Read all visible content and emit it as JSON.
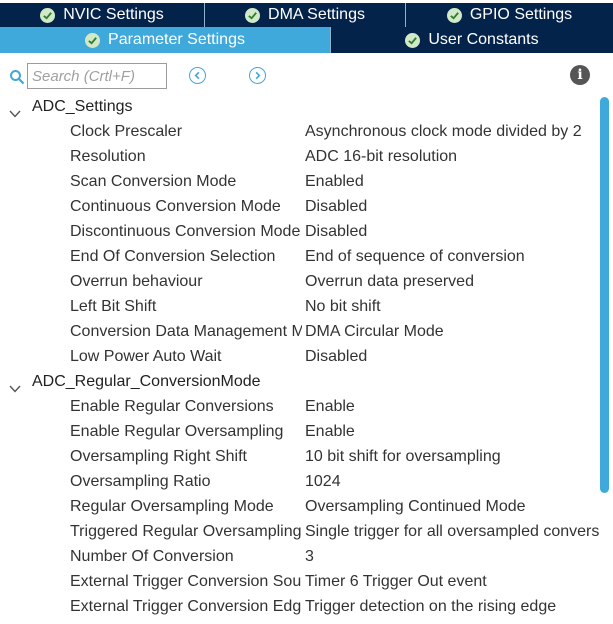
{
  "tabs_top": [
    {
      "label": "NVIC Settings"
    },
    {
      "label": "DMA Settings"
    },
    {
      "label": "GPIO Settings"
    }
  ],
  "tabs_bottom": [
    {
      "label": "Parameter Settings",
      "active": true
    },
    {
      "label": "User Constants",
      "active": false
    }
  ],
  "search": {
    "placeholder": "Search (Crtl+F)"
  },
  "icons": {
    "search": "search-icon",
    "prev": "arrow-left-icon",
    "next": "arrow-right-icon",
    "info": "info-icon"
  },
  "colors": {
    "tab_dark": "#03234b",
    "tab_active": "#3fa9dc",
    "scroll_thumb": "#3fa9dc"
  },
  "groups": [
    {
      "label": "ADC_Settings",
      "params": [
        {
          "name": "Clock Prescaler",
          "value": "Asynchronous clock mode divided by 2"
        },
        {
          "name": "Resolution",
          "value": "ADC 16-bit resolution"
        },
        {
          "name": "Scan Conversion Mode",
          "value": "Enabled"
        },
        {
          "name": "Continuous Conversion Mode",
          "value": "Disabled"
        },
        {
          "name": "Discontinuous Conversion Mode",
          "value": "Disabled"
        },
        {
          "name": "End Of Conversion Selection",
          "value": "End of sequence of conversion"
        },
        {
          "name": "Overrun behaviour",
          "value": "Overrun data preserved"
        },
        {
          "name": "Left Bit Shift",
          "value": "No bit shift"
        },
        {
          "name": "Conversion Data Management M.",
          "value": "DMA Circular Mode"
        },
        {
          "name": "Low Power Auto Wait",
          "value": "Disabled"
        }
      ]
    },
    {
      "label": "ADC_Regular_ConversionMode",
      "params": [
        {
          "name": "Enable Regular Conversions",
          "value": "Enable"
        },
        {
          "name": "Enable Regular Oversampling",
          "value": "Enable"
        },
        {
          "name": "Oversampling Right Shift",
          "value": "10 bit shift for oversampling"
        },
        {
          "name": "Oversampling Ratio",
          "value": "1024"
        },
        {
          "name": "Regular Oversampling Mode",
          "value": "Oversampling Continued Mode"
        },
        {
          "name": "Triggered Regular Oversampling",
          "value": "Single trigger for all oversampled conversi."
        },
        {
          "name": "Number Of Conversion",
          "value": "3"
        },
        {
          "name": "External Trigger Conversion Sou.",
          "value": "Timer 6 Trigger Out event"
        },
        {
          "name": "External Trigger Conversion Edg.",
          "value": "Trigger detection on the rising edge"
        }
      ]
    }
  ]
}
